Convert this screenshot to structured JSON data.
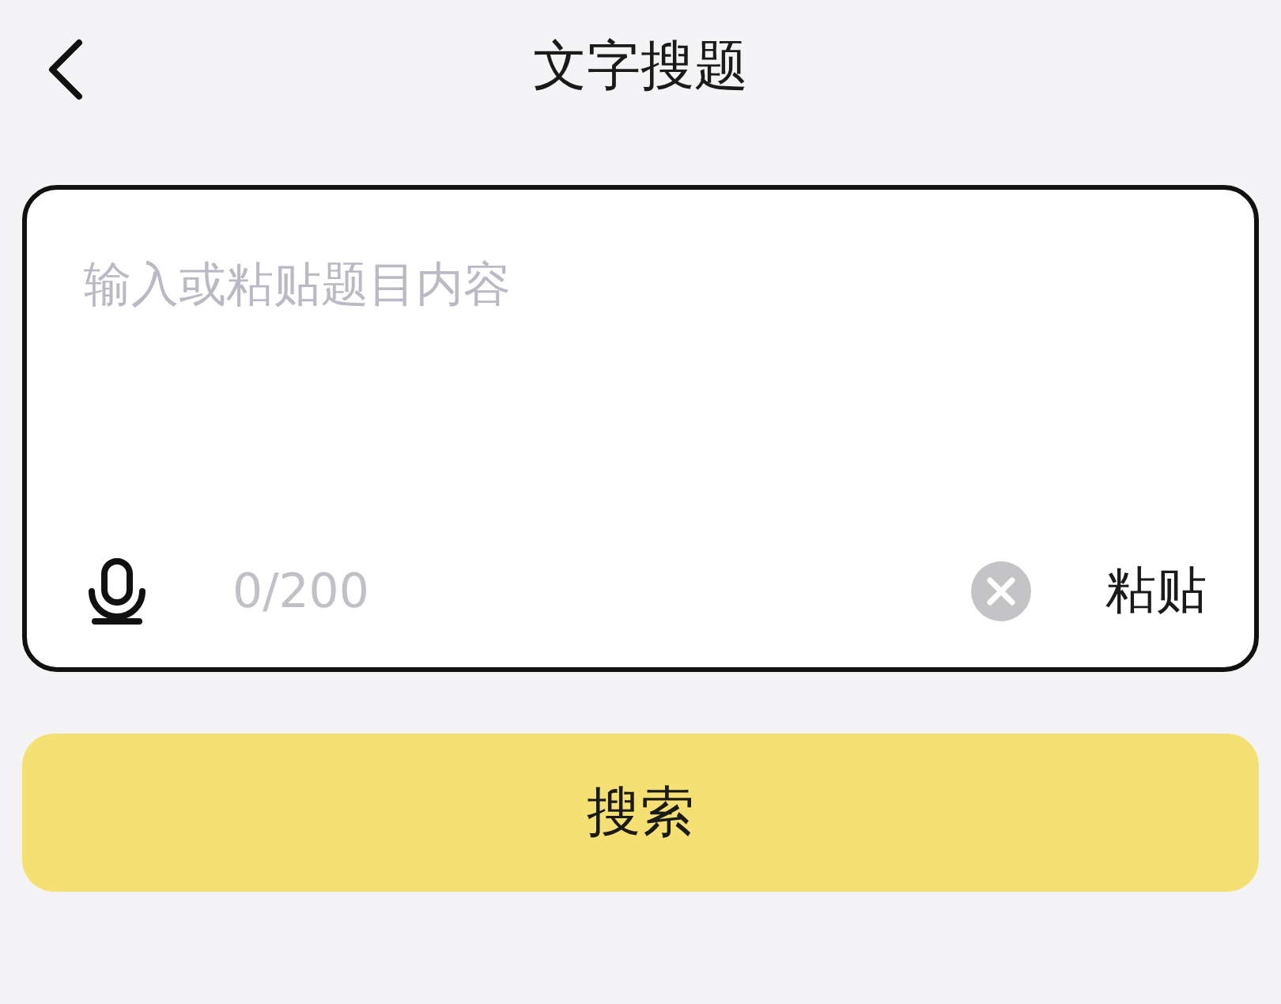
{
  "header": {
    "title": "文字搜题"
  },
  "input": {
    "placeholder": "输入或粘贴题目内容",
    "counter": "0/200",
    "paste_label": "粘贴"
  },
  "search_button": {
    "label": "搜索"
  }
}
